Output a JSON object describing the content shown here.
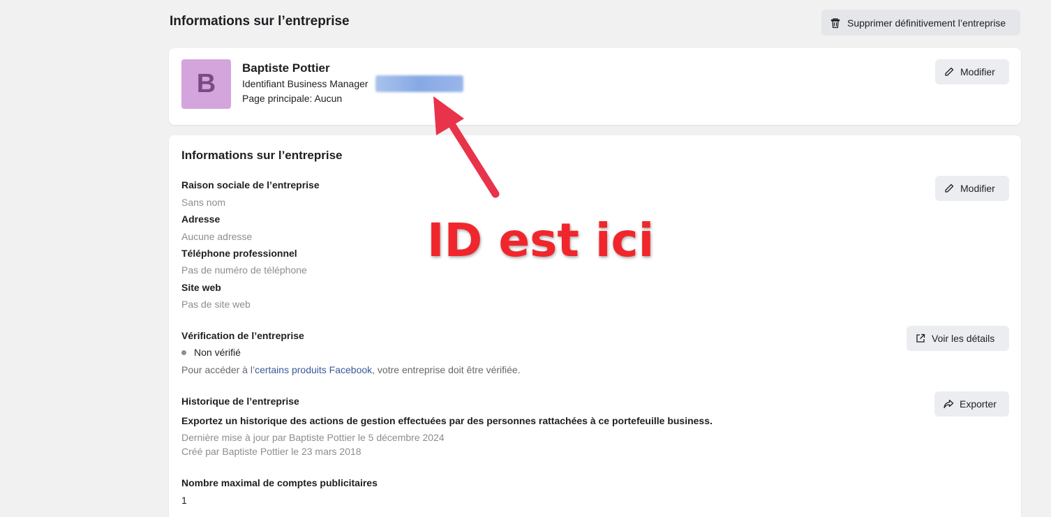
{
  "header": {
    "title": "Informations sur l’entreprise",
    "delete_button": "Supprimer définitivement l’entreprise",
    "delete_icon": "trash-icon"
  },
  "profile": {
    "avatar_letter": "B",
    "avatar_color": "#d4a4dc",
    "name": "Baptiste Pottier",
    "id_label": "Identifiant Business Manager",
    "main_page": "Page principale: Aucun",
    "edit_button": "Modifier"
  },
  "info": {
    "title": "Informations sur l’entreprise",
    "edit_button": "Modifier",
    "fields": [
      {
        "label": "Raison sociale de l’entreprise",
        "value": "Sans nom"
      },
      {
        "label": "Adresse",
        "value": "Aucune adresse"
      },
      {
        "label": "Téléphone professionnel",
        "value": "Pas de numéro de téléphone"
      },
      {
        "label": "Site web",
        "value": "Pas de site web"
      }
    ],
    "verification": {
      "label": "Vérification de l’entreprise",
      "status": "Non vérifié",
      "note_prefix": "Pour accéder à l’",
      "note_link": "certains produits Facebook",
      "note_suffix": ", votre entreprise doit être vérifiée.",
      "details_button": "Voir les détails"
    },
    "history": {
      "label": "Historique de l’entreprise",
      "description": "Exportez un historique des actions de gestion effectuées par des personnes rattachées à ce portefeuille business.",
      "updated": "Dernière mise à jour par Baptiste Pottier le 5 décembre 2024",
      "created": "Créé par Baptiste Pottier le 23 mars 2018",
      "export_button": "Exporter"
    },
    "max_accounts": {
      "label": "Nombre maximal de comptes publicitaires",
      "value": "1"
    }
  },
  "annotation": {
    "text": "ID est ici",
    "color": "#f0262c"
  }
}
